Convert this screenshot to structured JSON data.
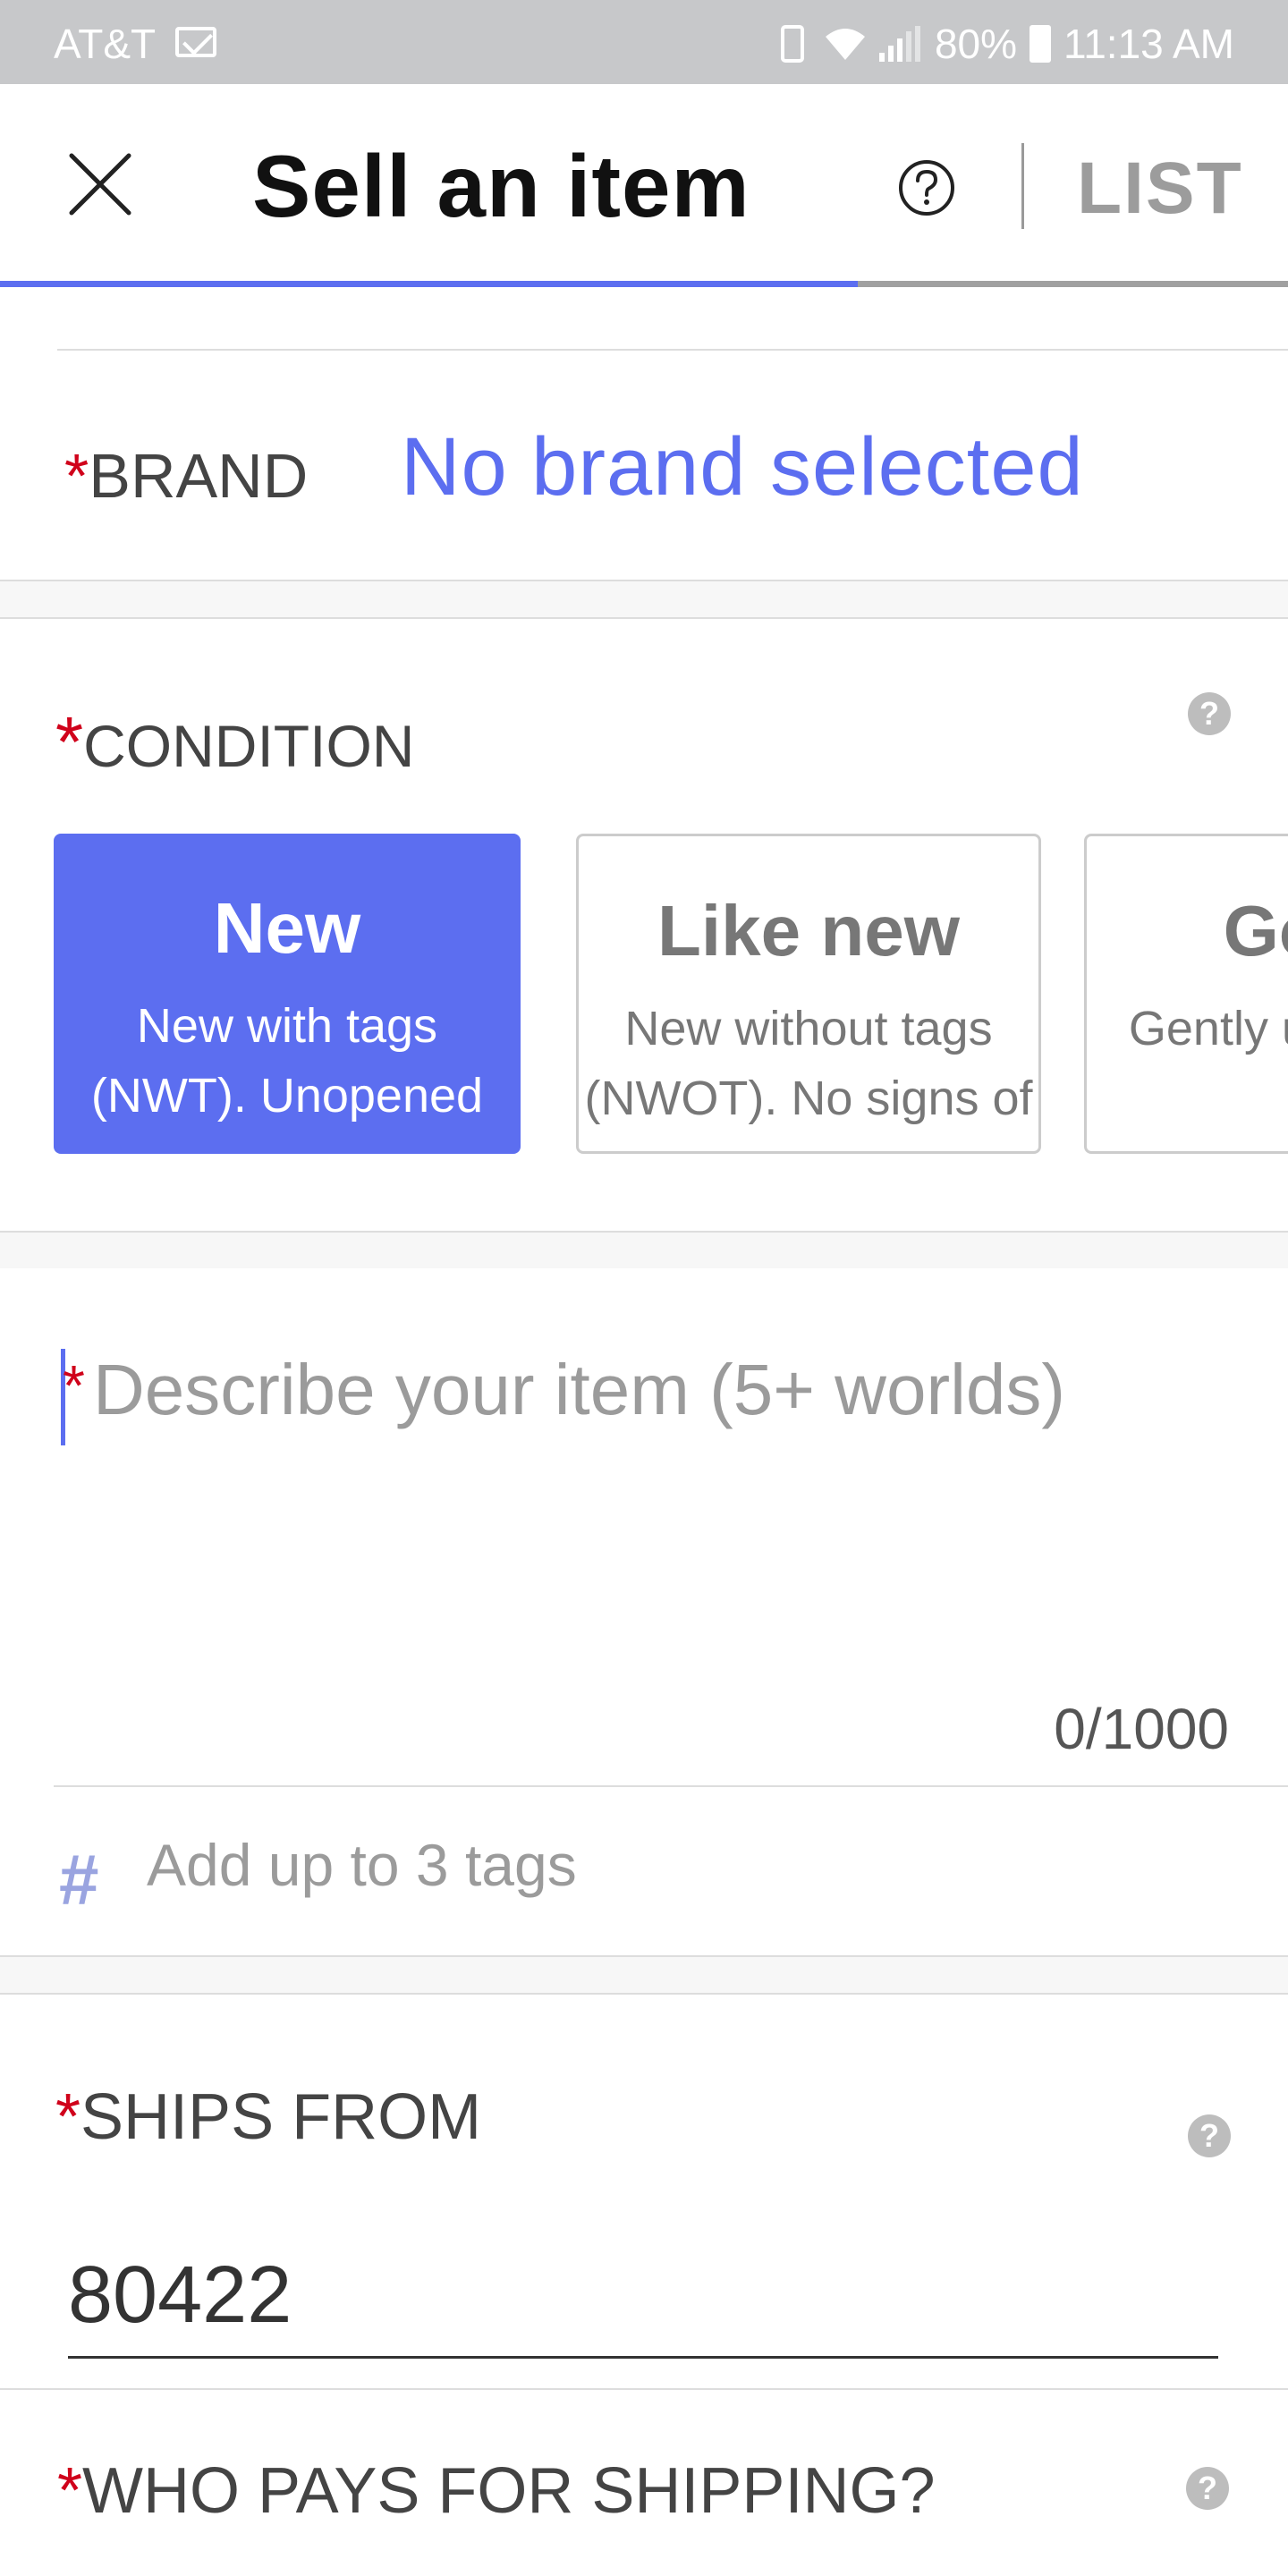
{
  "status_bar": {
    "carrier": "AT&T",
    "battery": "80%",
    "time": "11:13 AM",
    "icons": [
      "mail-icon",
      "vibrate-icon",
      "wifi-icon",
      "signal-icon",
      "battery-icon"
    ]
  },
  "header": {
    "title": "Sell an item",
    "list_label": "LIST",
    "progress_percent": 66.6,
    "accent_color": "#5c6ef0",
    "icons": [
      "close-icon",
      "help-icon"
    ]
  },
  "brand": {
    "required_mark": "*",
    "label": "BRAND",
    "value": "No brand selected"
  },
  "condition": {
    "required_mark": "*",
    "label": "CONDITION",
    "info": "?",
    "options": [
      {
        "title": "New",
        "description": "New with tags (NWT). Unopened",
        "selected": true
      },
      {
        "title": "Like new",
        "description": "New without tags (NWOT). No signs of",
        "selected": false
      },
      {
        "title": "Good",
        "description": "Gently used. One",
        "selected": false
      }
    ]
  },
  "description": {
    "required_mark": "*",
    "placeholder": "Describe your item (5+ worlds)",
    "value": "",
    "char_count": "0/1000"
  },
  "tags": {
    "placeholder": "Add up to 3 tags"
  },
  "ships_from": {
    "required_mark": "*",
    "label": "SHIPS FROM",
    "info": "?",
    "zip": "80422"
  },
  "who_pays": {
    "required_mark": "*",
    "label": "WHO PAYS FOR SHIPPING?",
    "info": "?"
  }
}
